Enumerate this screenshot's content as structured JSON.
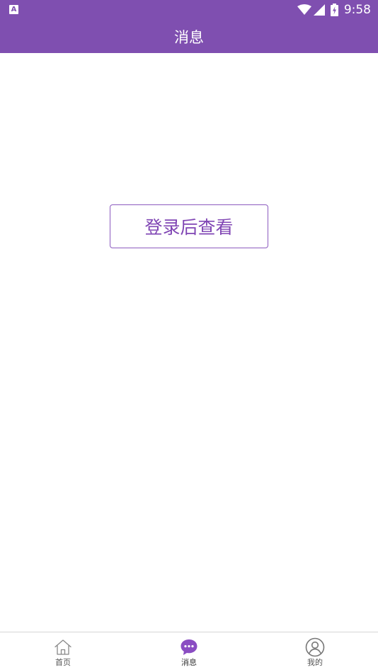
{
  "status_bar": {
    "notification_icon": "A",
    "time": "9:58",
    "icons": [
      "wifi-icon",
      "signal-icon",
      "battery-charging-icon"
    ]
  },
  "header": {
    "title": "消息"
  },
  "main": {
    "login_button_label": "登录后查看"
  },
  "tabs": [
    {
      "label": "首页",
      "icon": "home-icon",
      "active": false
    },
    {
      "label": "消息",
      "icon": "message-icon",
      "active": true
    },
    {
      "label": "我的",
      "icon": "profile-icon",
      "active": false
    }
  ],
  "colors": {
    "primary": "#7f4fb0",
    "button_text": "#8046b4",
    "button_border": "#8c5bbf",
    "tab_inactive_icon": "#888888",
    "tab_active_icon": "#8a4dc2"
  }
}
